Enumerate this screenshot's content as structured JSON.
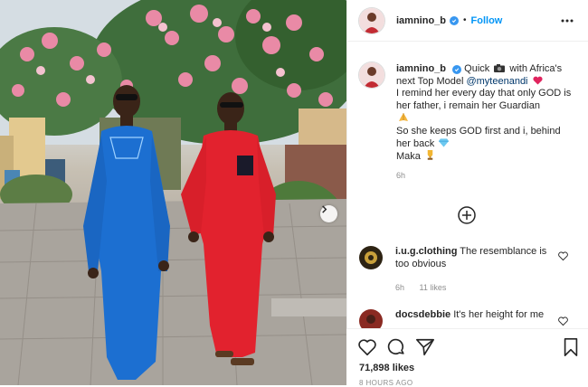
{
  "post": {
    "username": "iamnino_b",
    "follow_label": "Follow",
    "separator": "•"
  },
  "caption": {
    "username": "iamnino_b",
    "parts": {
      "a": "Quick",
      "b": "with Africa's next Top Model",
      "mention": "@myteenandi",
      "c": "I remind her every day that only GOD is her father, i remain her Guardian",
      "d": "So she keeps GOD first and i, behind her back",
      "e": "Maka"
    },
    "time": "6h"
  },
  "comments": [
    {
      "username": "i.u.g.clothing",
      "text": "The resemblance is too obvious",
      "time": "6h",
      "likes": "11 likes"
    },
    {
      "username": "docsdebbie",
      "text": "It's her height for me"
    }
  ],
  "likes": "71,898 likes",
  "posted_ago": "8 HOURS AGO",
  "icons": {
    "verified": "verified-badge-icon",
    "more": "more-options-icon",
    "load_more": "plus-circle-icon",
    "like": "heart-icon",
    "comment": "comment-icon",
    "share": "send-icon",
    "save": "bookmark-icon",
    "next": "chevron-right-icon"
  },
  "colors": {
    "link": "#0095f6",
    "verified": "#3897f0",
    "mention": "#00376b",
    "meta": "#8e8e8e"
  }
}
